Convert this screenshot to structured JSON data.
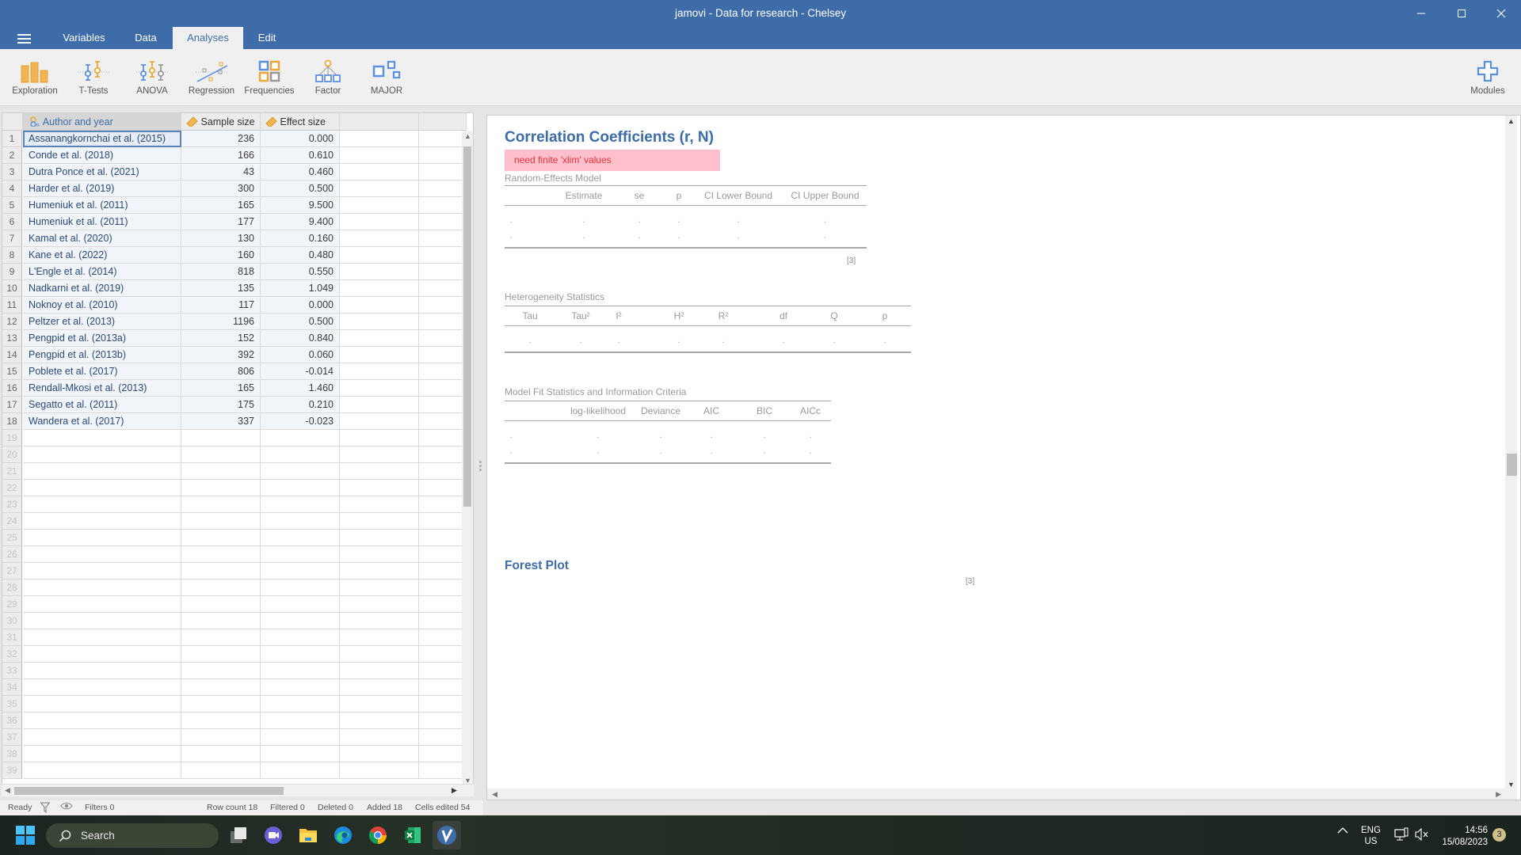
{
  "window": {
    "title": "jamovi - Data for research - Chelsey",
    "controls": [
      "minimize-icon",
      "maximize-icon",
      "close-icon"
    ]
  },
  "tabs": [
    {
      "label": "Variables",
      "active": false
    },
    {
      "label": "Data",
      "active": false
    },
    {
      "label": "Analyses",
      "active": true
    },
    {
      "label": "Edit",
      "active": false
    }
  ],
  "ribbon": {
    "items": [
      {
        "label": "Exploration",
        "icon": "exploration-icon"
      },
      {
        "label": "T-Tests",
        "icon": "t-tests-icon"
      },
      {
        "label": "ANOVA",
        "icon": "anova-icon"
      },
      {
        "label": "Regression",
        "icon": "regression-icon"
      },
      {
        "label": "Frequencies",
        "icon": "frequencies-icon"
      },
      {
        "label": "Factor",
        "icon": "factor-icon"
      },
      {
        "label": "MAJOR",
        "icon": "major-icon"
      }
    ],
    "modules_label": "Modules"
  },
  "grid": {
    "columns": [
      {
        "name": "Author and year",
        "type": "nominal-text",
        "icon": "nominal-text-icon"
      },
      {
        "name": "Sample size",
        "type": "continuous",
        "icon": "ruler-icon"
      },
      {
        "name": "Effect size",
        "type": "continuous",
        "icon": "ruler-icon"
      }
    ],
    "rows": [
      [
        "Assanangkornchai et al. (2015)",
        "236",
        "0.000"
      ],
      [
        "Conde et al. (2018)",
        "166",
        "0.610"
      ],
      [
        "Dutra Ponce et al. (2021)",
        "43",
        "0.460"
      ],
      [
        "Harder et al. (2019)",
        "300",
        "0.500"
      ],
      [
        "Humeniuk et al. (2011)",
        "165",
        "9.500"
      ],
      [
        "Humeniuk et al. (2011)",
        "177",
        "9.400"
      ],
      [
        "Kamal et al. (2020)",
        "130",
        "0.160"
      ],
      [
        "Kane et al. (2022)",
        "160",
        "0.480"
      ],
      [
        "L'Engle et al. (2014)",
        "818",
        "0.550"
      ],
      [
        "Nadkarni et al. (2019)",
        "135",
        "1.049"
      ],
      [
        "Noknoy et al. (2010)",
        "117",
        "0.000"
      ],
      [
        "Peltzer et al. (2013)",
        "1196",
        "0.500"
      ],
      [
        "Pengpid et al. (2013a)",
        "152",
        "0.840"
      ],
      [
        "Pengpid et al. (2013b)",
        "392",
        "0.060"
      ],
      [
        "Poblete et al. (2017)",
        "806",
        "-0.014"
      ],
      [
        "Rendall-Mkosi et al. (2013)",
        "165",
        "1.460"
      ],
      [
        "Segatto et al. (2011)",
        "175",
        "0.210"
      ],
      [
        "Wandera et al. (2017)",
        "337",
        "-0.023"
      ]
    ],
    "visible_row_count": 39,
    "selected_cell": {
      "row": 1,
      "column": "Author and year"
    }
  },
  "status": {
    "ready": "Ready",
    "filters": "Filters 0",
    "row_count": "Row count 18",
    "filtered": "Filtered 0",
    "deleted": "Deleted 0",
    "added": "Added 18",
    "cells_edited": "Cells edited 54"
  },
  "results": {
    "title": "Correlation Coefficients (r, N)",
    "error": "need finite 'xlim' values",
    "random_effects": {
      "caption": "Random-Effects Model",
      "headers": [
        "",
        "Estimate",
        "se",
        "p",
        "CI Lower Bound",
        "CI Upper Bound"
      ],
      "rows": [
        [
          ".",
          ".",
          ".",
          ".",
          ".",
          "."
        ],
        [
          ".",
          ".",
          ".",
          ".",
          ".",
          "."
        ]
      ],
      "reference": "[3]"
    },
    "heterogeneity": {
      "caption": "Heterogeneity Statistics",
      "headers": [
        "Tau",
        "Tau²",
        "I²",
        "H²",
        "R²",
        "df",
        "Q",
        "p"
      ],
      "rows": [
        [
          ".",
          ".",
          ".",
          ".",
          ".",
          ".",
          ".",
          "."
        ]
      ]
    },
    "model_fit": {
      "caption": "Model Fit Statistics and Information Criteria",
      "headers": [
        "",
        "log-likelihood",
        "Deviance",
        "AIC",
        "BIC",
        "AICc"
      ],
      "rows": [
        [
          ".",
          ".",
          ".",
          ".",
          ".",
          "."
        ],
        [
          ".",
          ".",
          ".",
          ".",
          ".",
          "."
        ]
      ]
    },
    "forest_plot": {
      "title": "Forest Plot",
      "reference": "[3]"
    }
  },
  "taskbar": {
    "search_placeholder": "Search",
    "apps": [
      "task-view-icon",
      "teams-icon",
      "file-explorer-icon",
      "edge-icon",
      "chrome-icon",
      "excel-icon",
      "jamovi-icon"
    ],
    "language": "ENG",
    "region": "US",
    "time": "14:56",
    "date": "15/08/2023",
    "notifications": "3"
  }
}
